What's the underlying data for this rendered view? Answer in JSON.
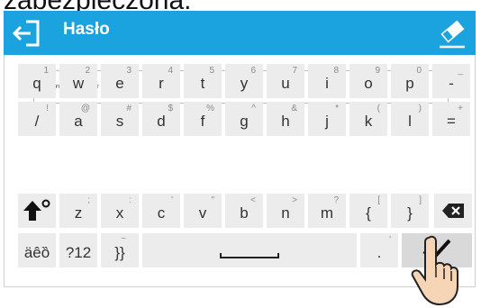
{
  "caption": "zabezpieczona.",
  "header": {
    "title": "Hasło",
    "back_icon": "exit-arrow-icon",
    "eraser_icon": "eraser-icon"
  },
  "password": {
    "value": "************"
  },
  "keyboard": {
    "row1": [
      {
        "main": "q",
        "sec": "1"
      },
      {
        "main": "w",
        "sec": "2"
      },
      {
        "main": "e",
        "sec": "3"
      },
      {
        "main": "r",
        "sec": "4"
      },
      {
        "main": "t",
        "sec": "5"
      },
      {
        "main": "y",
        "sec": "6"
      },
      {
        "main": "u",
        "sec": "7"
      },
      {
        "main": "i",
        "sec": "8"
      },
      {
        "main": "o",
        "sec": "9"
      },
      {
        "main": "p",
        "sec": "0"
      },
      {
        "main": "-",
        "sec": "_"
      }
    ],
    "row2": [
      {
        "main": "/",
        "sec": "!"
      },
      {
        "main": "a",
        "sec": "@"
      },
      {
        "main": "s",
        "sec": "#"
      },
      {
        "main": "d",
        "sec": "$"
      },
      {
        "main": "f",
        "sec": "%"
      },
      {
        "main": "g",
        "sec": "^"
      },
      {
        "main": "h",
        "sec": "&"
      },
      {
        "main": "j",
        "sec": "*"
      },
      {
        "main": "k",
        "sec": "("
      },
      {
        "main": "l",
        "sec": ")"
      },
      {
        "main": "=",
        "sec": "+"
      }
    ],
    "row3": [
      {
        "main": "z",
        "sec": ";"
      },
      {
        "main": "x",
        "sec": ":"
      },
      {
        "main": "c",
        "sec": "'"
      },
      {
        "main": "v",
        "sec": "\""
      },
      {
        "main": "b",
        "sec": "<"
      },
      {
        "main": "n",
        "sec": ">"
      },
      {
        "main": "m",
        "sec": "?"
      },
      {
        "main": "{",
        "sec": "["
      },
      {
        "main": "}",
        "sec": "]"
      }
    ],
    "diacritics_label": "äêȍ",
    "num_label": "?12",
    "brackets_label": "}}",
    "brackets_sec": "~",
    "dot_label": ".",
    "dot_sec": "'"
  },
  "colors": {
    "header": "#1aa3df",
    "key": "#ececec",
    "key_dark": "#d9d9d9"
  }
}
